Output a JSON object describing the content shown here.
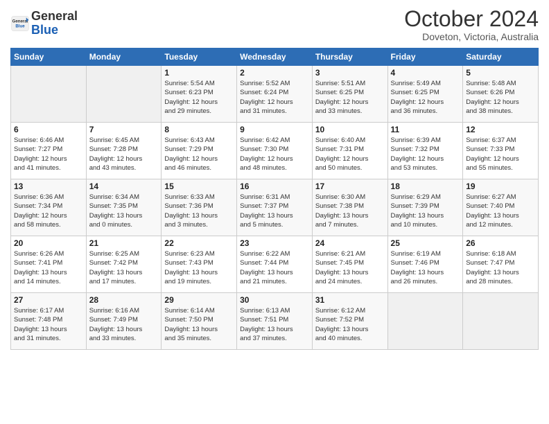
{
  "header": {
    "logo_text_general": "General",
    "logo_text_blue": "Blue",
    "month_title": "October 2024",
    "location": "Doveton, Victoria, Australia"
  },
  "days_of_week": [
    "Sunday",
    "Monday",
    "Tuesday",
    "Wednesday",
    "Thursday",
    "Friday",
    "Saturday"
  ],
  "weeks": [
    [
      {
        "day": "",
        "info": ""
      },
      {
        "day": "",
        "info": ""
      },
      {
        "day": "1",
        "info": "Sunrise: 5:54 AM\nSunset: 6:23 PM\nDaylight: 12 hours\nand 29 minutes."
      },
      {
        "day": "2",
        "info": "Sunrise: 5:52 AM\nSunset: 6:24 PM\nDaylight: 12 hours\nand 31 minutes."
      },
      {
        "day": "3",
        "info": "Sunrise: 5:51 AM\nSunset: 6:25 PM\nDaylight: 12 hours\nand 33 minutes."
      },
      {
        "day": "4",
        "info": "Sunrise: 5:49 AM\nSunset: 6:25 PM\nDaylight: 12 hours\nand 36 minutes."
      },
      {
        "day": "5",
        "info": "Sunrise: 5:48 AM\nSunset: 6:26 PM\nDaylight: 12 hours\nand 38 minutes."
      }
    ],
    [
      {
        "day": "6",
        "info": "Sunrise: 6:46 AM\nSunset: 7:27 PM\nDaylight: 12 hours\nand 41 minutes."
      },
      {
        "day": "7",
        "info": "Sunrise: 6:45 AM\nSunset: 7:28 PM\nDaylight: 12 hours\nand 43 minutes."
      },
      {
        "day": "8",
        "info": "Sunrise: 6:43 AM\nSunset: 7:29 PM\nDaylight: 12 hours\nand 46 minutes."
      },
      {
        "day": "9",
        "info": "Sunrise: 6:42 AM\nSunset: 7:30 PM\nDaylight: 12 hours\nand 48 minutes."
      },
      {
        "day": "10",
        "info": "Sunrise: 6:40 AM\nSunset: 7:31 PM\nDaylight: 12 hours\nand 50 minutes."
      },
      {
        "day": "11",
        "info": "Sunrise: 6:39 AM\nSunset: 7:32 PM\nDaylight: 12 hours\nand 53 minutes."
      },
      {
        "day": "12",
        "info": "Sunrise: 6:37 AM\nSunset: 7:33 PM\nDaylight: 12 hours\nand 55 minutes."
      }
    ],
    [
      {
        "day": "13",
        "info": "Sunrise: 6:36 AM\nSunset: 7:34 PM\nDaylight: 12 hours\nand 58 minutes."
      },
      {
        "day": "14",
        "info": "Sunrise: 6:34 AM\nSunset: 7:35 PM\nDaylight: 13 hours\nand 0 minutes."
      },
      {
        "day": "15",
        "info": "Sunrise: 6:33 AM\nSunset: 7:36 PM\nDaylight: 13 hours\nand 3 minutes."
      },
      {
        "day": "16",
        "info": "Sunrise: 6:31 AM\nSunset: 7:37 PM\nDaylight: 13 hours\nand 5 minutes."
      },
      {
        "day": "17",
        "info": "Sunrise: 6:30 AM\nSunset: 7:38 PM\nDaylight: 13 hours\nand 7 minutes."
      },
      {
        "day": "18",
        "info": "Sunrise: 6:29 AM\nSunset: 7:39 PM\nDaylight: 13 hours\nand 10 minutes."
      },
      {
        "day": "19",
        "info": "Sunrise: 6:27 AM\nSunset: 7:40 PM\nDaylight: 13 hours\nand 12 minutes."
      }
    ],
    [
      {
        "day": "20",
        "info": "Sunrise: 6:26 AM\nSunset: 7:41 PM\nDaylight: 13 hours\nand 14 minutes."
      },
      {
        "day": "21",
        "info": "Sunrise: 6:25 AM\nSunset: 7:42 PM\nDaylight: 13 hours\nand 17 minutes."
      },
      {
        "day": "22",
        "info": "Sunrise: 6:23 AM\nSunset: 7:43 PM\nDaylight: 13 hours\nand 19 minutes."
      },
      {
        "day": "23",
        "info": "Sunrise: 6:22 AM\nSunset: 7:44 PM\nDaylight: 13 hours\nand 21 minutes."
      },
      {
        "day": "24",
        "info": "Sunrise: 6:21 AM\nSunset: 7:45 PM\nDaylight: 13 hours\nand 24 minutes."
      },
      {
        "day": "25",
        "info": "Sunrise: 6:19 AM\nSunset: 7:46 PM\nDaylight: 13 hours\nand 26 minutes."
      },
      {
        "day": "26",
        "info": "Sunrise: 6:18 AM\nSunset: 7:47 PM\nDaylight: 13 hours\nand 28 minutes."
      }
    ],
    [
      {
        "day": "27",
        "info": "Sunrise: 6:17 AM\nSunset: 7:48 PM\nDaylight: 13 hours\nand 31 minutes."
      },
      {
        "day": "28",
        "info": "Sunrise: 6:16 AM\nSunset: 7:49 PM\nDaylight: 13 hours\nand 33 minutes."
      },
      {
        "day": "29",
        "info": "Sunrise: 6:14 AM\nSunset: 7:50 PM\nDaylight: 13 hours\nand 35 minutes."
      },
      {
        "day": "30",
        "info": "Sunrise: 6:13 AM\nSunset: 7:51 PM\nDaylight: 13 hours\nand 37 minutes."
      },
      {
        "day": "31",
        "info": "Sunrise: 6:12 AM\nSunset: 7:52 PM\nDaylight: 13 hours\nand 40 minutes."
      },
      {
        "day": "",
        "info": ""
      },
      {
        "day": "",
        "info": ""
      }
    ]
  ]
}
